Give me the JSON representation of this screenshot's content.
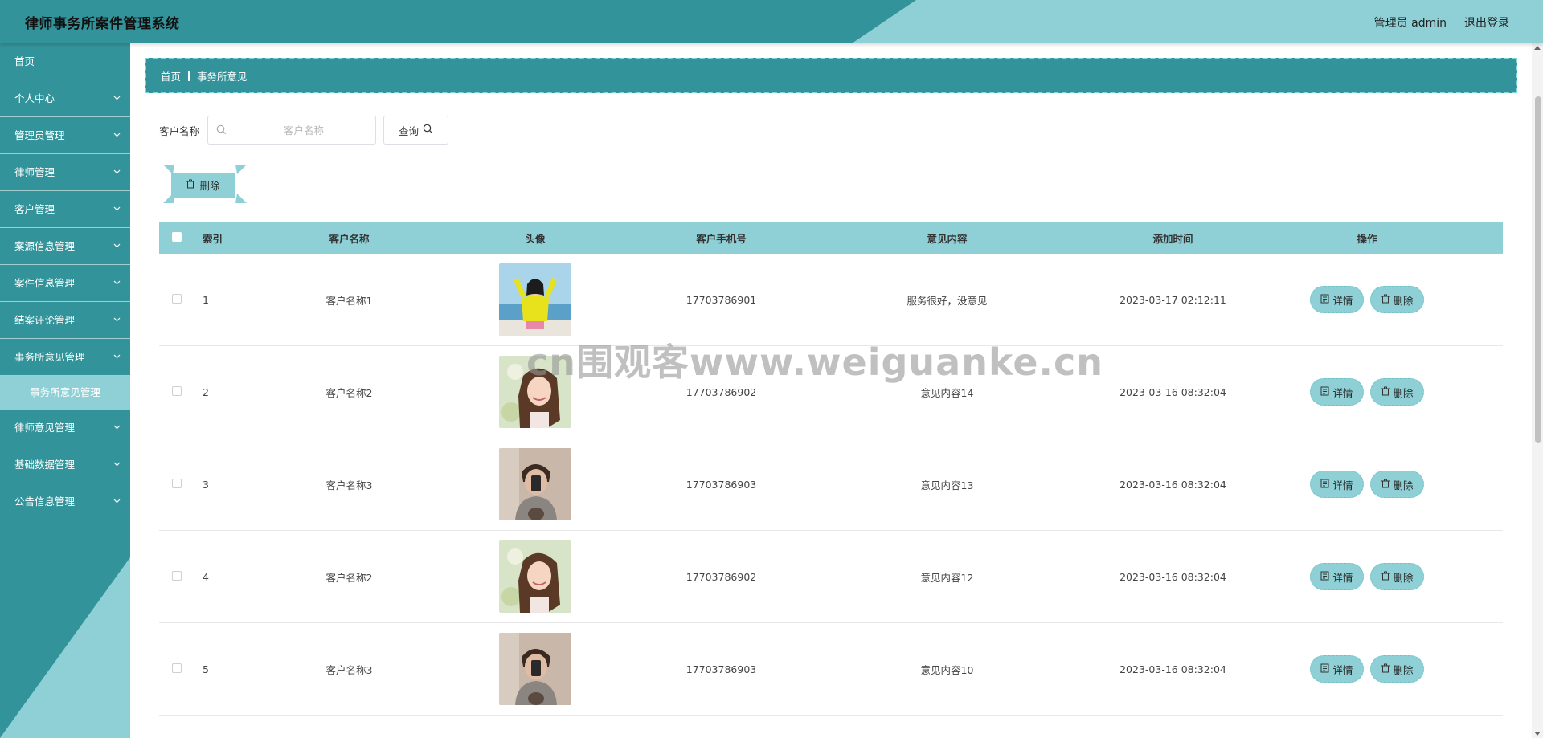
{
  "header": {
    "title": "律师事务所案件管理系统",
    "user_label": "管理员 admin",
    "logout_label": "退出登录"
  },
  "sidebar": {
    "items": [
      {
        "label": "首页",
        "has_children": false
      },
      {
        "label": "个人中心",
        "has_children": true
      },
      {
        "label": "管理员管理",
        "has_children": true
      },
      {
        "label": "律师管理",
        "has_children": true
      },
      {
        "label": "客户管理",
        "has_children": true
      },
      {
        "label": "案源信息管理",
        "has_children": true
      },
      {
        "label": "案件信息管理",
        "has_children": true
      },
      {
        "label": "结案评论管理",
        "has_children": true
      },
      {
        "label": "事务所意见管理",
        "has_children": true,
        "expanded": true
      },
      {
        "label": "事务所意见管理",
        "is_sub": true,
        "active": true
      },
      {
        "label": "律师意见管理",
        "has_children": true
      },
      {
        "label": "基础数据管理",
        "has_children": true
      },
      {
        "label": "公告信息管理",
        "has_children": true
      }
    ]
  },
  "breadcrumb": {
    "home": "首页",
    "current": "事务所意见"
  },
  "search": {
    "label": "客户名称",
    "placeholder": "客户名称",
    "value": "",
    "query_label": "查询"
  },
  "toolbar": {
    "delete_label": "删除"
  },
  "table": {
    "columns": [
      "索引",
      "客户名称",
      "头像",
      "客户手机号",
      "意见内容",
      "添加时间",
      "操作"
    ],
    "rows": [
      {
        "index": "1",
        "name": "客户名称1",
        "avatar": "avatar-girl-yellow",
        "phone": "17703786901",
        "content": "服务很好，没意见",
        "time": "2023-03-17 02:12:11",
        "detail": "详情",
        "delete": "删除"
      },
      {
        "index": "2",
        "name": "客户名称2",
        "avatar": "avatar-girl-smile",
        "phone": "17703786902",
        "content": "意见内容14",
        "time": "2023-03-16 08:32:04",
        "detail": "详情",
        "delete": "删除"
      },
      {
        "index": "3",
        "name": "客户名称3",
        "avatar": "avatar-boy-phone",
        "phone": "17703786903",
        "content": "意见内容13",
        "time": "2023-03-16 08:32:04",
        "detail": "详情",
        "delete": "删除"
      },
      {
        "index": "4",
        "name": "客户名称2",
        "avatar": "avatar-girl-smile",
        "phone": "17703786902",
        "content": "意见内容12",
        "time": "2023-03-16 08:32:04",
        "detail": "详情",
        "delete": "删除"
      },
      {
        "index": "5",
        "name": "客户名称3",
        "avatar": "avatar-boy-phone",
        "phone": "17703786903",
        "content": "意见内容10",
        "time": "2023-03-16 08:32:04",
        "detail": "详情",
        "delete": "删除"
      }
    ]
  },
  "watermark": "cn围观客www.weiguanke.cn",
  "colors": {
    "primary_dark": "#32939a",
    "primary_light": "#8fd0d6"
  }
}
